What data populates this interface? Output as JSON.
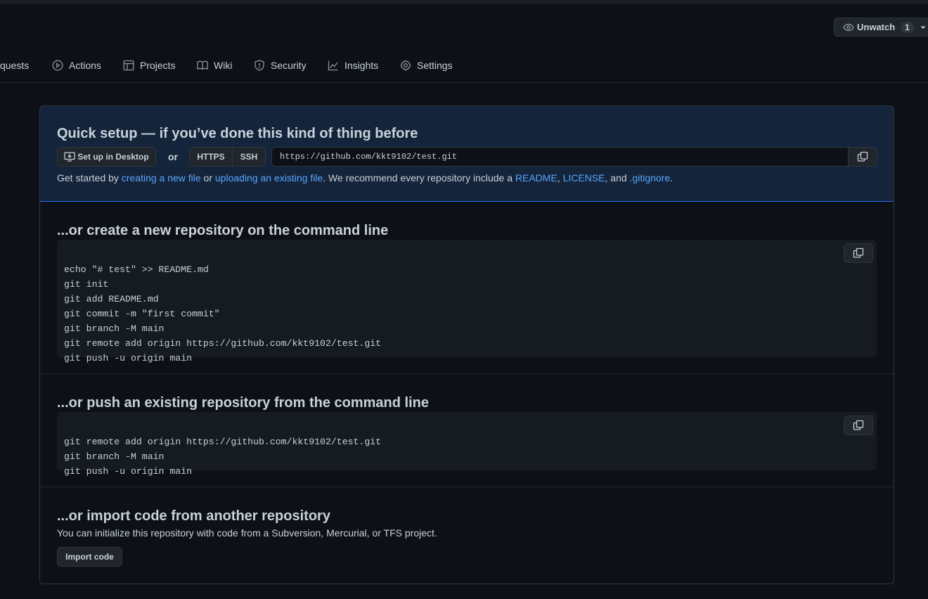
{
  "header": {
    "watch": {
      "label": "Unwatch",
      "count": "1"
    }
  },
  "tabs": [
    {
      "label": "quests",
      "icon": "pull-request-icon"
    },
    {
      "label": "Actions",
      "icon": "play-icon"
    },
    {
      "label": "Projects",
      "icon": "table-icon"
    },
    {
      "label": "Wiki",
      "icon": "book-icon"
    },
    {
      "label": "Security",
      "icon": "shield-icon"
    },
    {
      "label": "Insights",
      "icon": "graph-icon"
    },
    {
      "label": "Settings",
      "icon": "gear-icon"
    }
  ],
  "quick_setup": {
    "title": "Quick setup — if you’ve done this kind of thing before",
    "desktop_button": "Set up in Desktop",
    "or": "or",
    "protocols": [
      "HTTPS",
      "SSH"
    ],
    "active_protocol": "HTTPS",
    "url": "https://github.com/kkt9102/test.git",
    "help": {
      "t1": "Get started by ",
      "link1": "creating a new file",
      "t2": " or ",
      "link2": "uploading an existing file",
      "t3": ". We recommend every repository include a ",
      "link3": "README",
      "t4": ", ",
      "link4": "LICENSE",
      "t5": ", and ",
      "link5": ".gitignore",
      "t6": "."
    }
  },
  "create_section": {
    "title": "...or create a new repository on the command line",
    "lines": [
      "echo \"# test\" >> README.md",
      "git init",
      "git add README.md",
      "git commit -m \"first commit\"",
      "git branch -M main",
      "git remote add origin https://github.com/kkt9102/test.git",
      "git push -u origin main"
    ]
  },
  "push_section": {
    "title": "...or push an existing repository from the command line",
    "lines": [
      "git remote add origin https://github.com/kkt9102/test.git",
      "git branch -M main",
      "git push -u origin main"
    ]
  },
  "import_section": {
    "title": "...or import code from another repository",
    "description": "You can initialize this repository with code from a Subversion, Mercurial, or TFS project.",
    "button": "Import code"
  },
  "colors": {
    "background": "#0d1117",
    "link": "#58a6ff",
    "quick_setup_bg": "#14243a",
    "quick_setup_border": "#1f6feb"
  }
}
